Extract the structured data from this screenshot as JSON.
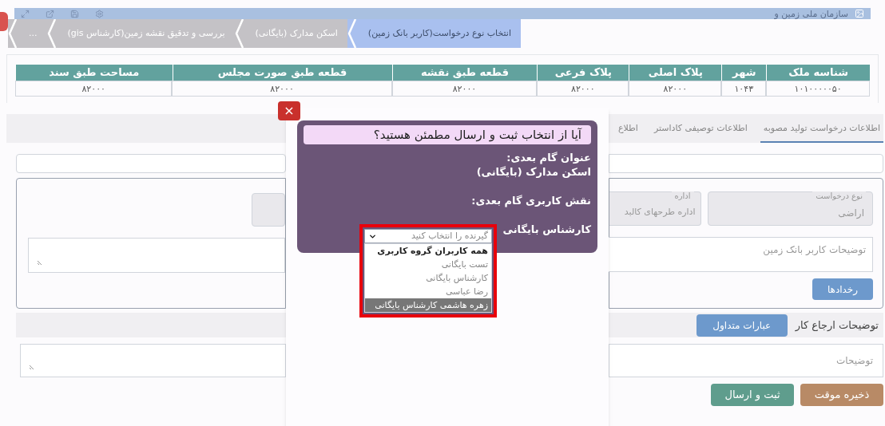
{
  "header": {
    "org_title": "سازمان ملی زمین و"
  },
  "breadcrumb": [
    {
      "label": "انتخاب نوع درخواست(کاربر بانک زمین)",
      "selected": true
    },
    {
      "label": "اسکن مدارک (بایگانی)",
      "selected": false
    },
    {
      "label": "بررسی و تدقیق نقشه زمین(کارشناس gis)",
      "selected": false
    },
    {
      "label": "...",
      "selected": false
    }
  ],
  "table": {
    "columns": [
      "شناسه ملک",
      "شهر",
      "پلاک اصلی",
      "پلاک فرعی",
      "قطعه طبق نقشه",
      "قطعه طبق صورت مجلس",
      "مساحت طبق سند"
    ],
    "rows": [
      [
        "۱۰۱۰۰۰۰۰۵۰",
        "۱۰۴۳",
        "۸۲۰۰۰",
        "۸۲۰۰۰",
        "۸۲۰۰۰",
        "۸۲۰۰۰",
        "۸۲۰۰۰"
      ]
    ]
  },
  "tabs": [
    {
      "label": "اطلاعات درخواست تولید مصوبه",
      "selected": true
    },
    {
      "label": "اطلاعات توصیفی کاداستر",
      "selected": false
    },
    {
      "label": "اطلاع",
      "selected": false
    }
  ],
  "form": {
    "request_type": {
      "label": "نوع درخواست",
      "value": "اراضی"
    },
    "office": {
      "label": "اداره",
      "value": "اداره طرحهای کالبد"
    },
    "bank_notes": {
      "placeholder": "توضیحات کاربر بانک زمین"
    },
    "events_button": "رخدادها",
    "referral_title": "توضیحات ارجاع کار",
    "phrases_button": "عبارات متداول",
    "notes": {
      "placeholder": "توضیحات"
    },
    "save_draft_button": "ذخیره موقت",
    "submit_button": "ثبت و ارسال"
  },
  "dialog": {
    "close": "×",
    "title": "آیا از انتخاب ثبت و ارسال مطمئن هستید؟",
    "next_step_label": "عنوان گام بعدی:",
    "next_step_value": "اسکن مدارک (بایگانی)",
    "next_role_label": "نقش کاربری گام بعدی:",
    "role_name": "کارشناس بایگانی",
    "select": {
      "placeholder": "گیرنده را انتخاب کنید"
    },
    "options": [
      {
        "label": "همه کاربران گروه کاربری",
        "kind": "group",
        "selected": false
      },
      {
        "label": "تست بایگانی",
        "kind": "user",
        "selected": false
      },
      {
        "label": "کارشناس بایگانی",
        "kind": "user",
        "selected": false
      },
      {
        "label": "رضا عباسی",
        "kind": "user",
        "selected": false
      },
      {
        "label": "زهره هاشمی کارشناس بایگانی",
        "kind": "user",
        "selected": true
      }
    ]
  }
}
